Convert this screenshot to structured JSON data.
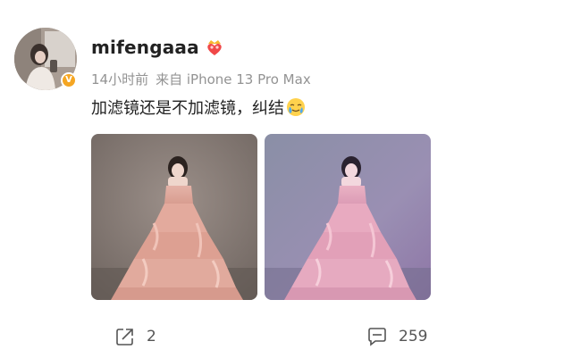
{
  "post": {
    "username": "mifengaaa",
    "time": "14小时前",
    "source": "来自 iPhone 13 Pro Max",
    "text": "加滤镜还是不加滤镜，纠结",
    "emoji_icon": "smiling-face-with-tear-icon",
    "badge_icon": "verified-v-icon",
    "vip_icon": "crown-heart-badge-icon",
    "verified_mark": "V",
    "photos": [
      {
        "alt": "photo-original",
        "tone": "warm-pink"
      },
      {
        "alt": "photo-filtered",
        "tone": "cool-lilac"
      }
    ],
    "actions": {
      "share_icon": "share-icon",
      "share_count": "2",
      "comment_icon": "comment-icon",
      "comment_count": "259"
    }
  },
  "colors": {
    "username": "#222222",
    "meta": "#939393",
    "badge": "#f5a623",
    "action_text": "#555555"
  }
}
